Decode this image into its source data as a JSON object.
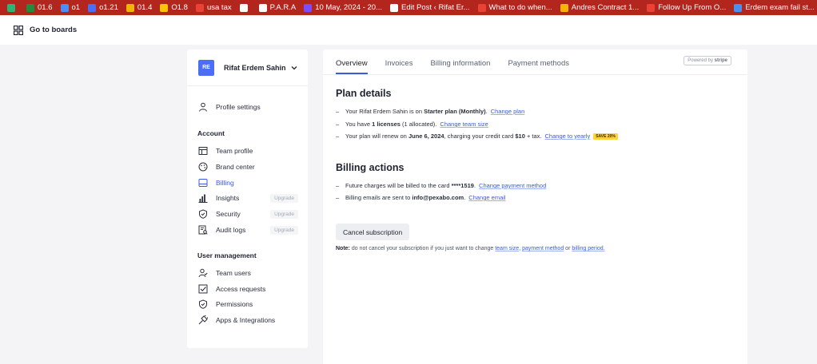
{
  "bookmarks": [
    {
      "label": "",
      "icon": "chat-icon",
      "color": "#2bb673"
    },
    {
      "label": "01.6",
      "icon": "plus-icon",
      "color": "#1e8e3e"
    },
    {
      "label": "o1",
      "icon": "shield-icon",
      "color": "#4c8df6"
    },
    {
      "label": "o1.21",
      "icon": "infinity-icon",
      "color": "#4c6ef5"
    },
    {
      "label": "01.4",
      "icon": "drive-icon",
      "color": "#f4b400"
    },
    {
      "label": "O1.8",
      "icon": "m-icon",
      "color": "#f9c400"
    },
    {
      "label": "usa tax",
      "icon": "gmail-icon",
      "color": "#ea4335"
    },
    {
      "label": "",
      "icon": "wordpress-icon",
      "color": "#ffffff"
    },
    {
      "label": "P.A.R.A",
      "icon": "folder-icon",
      "color": "#ffffff"
    },
    {
      "label": "10 May, 2024 - 20...",
      "icon": "clock-icon",
      "color": "#7c4dff"
    },
    {
      "label": "Edit Post ‹ Rifat Er...",
      "icon": "wordpress-icon",
      "color": "#ffffff"
    },
    {
      "label": "What to do when...",
      "icon": "gmail-icon",
      "color": "#ea4335"
    },
    {
      "label": "Andres Contract 1...",
      "icon": "drive-icon",
      "color": "#f4b400"
    },
    {
      "label": "Follow Up From O...",
      "icon": "gmail-icon",
      "color": "#ea4335"
    },
    {
      "label": "Erdem exam fail st...",
      "icon": "shield-icon",
      "color": "#4c8df6"
    },
    {
      "label": "",
      "icon": "calendar-icon",
      "color": "#4c8df6"
    },
    {
      "label": "",
      "icon": "app-icon",
      "color": "#ff6d00"
    }
  ],
  "topbar": {
    "go_to_boards": "Go to boards"
  },
  "workspace": {
    "initials": "RE",
    "name": "Rifat Erdem Sahin"
  },
  "sidebar": {
    "profile_settings": "Profile settings",
    "account_title": "Account",
    "account_items": [
      {
        "label": "Team profile",
        "icon": "team-profile-icon",
        "badge": ""
      },
      {
        "label": "Brand center",
        "icon": "palette-icon",
        "badge": ""
      },
      {
        "label": "Billing",
        "icon": "billing-icon",
        "badge": ""
      },
      {
        "label": "Insights",
        "icon": "insights-icon",
        "badge": "Upgrade"
      },
      {
        "label": "Security",
        "icon": "security-icon",
        "badge": "Upgrade"
      },
      {
        "label": "Audit logs",
        "icon": "audit-logs-icon",
        "badge": "Upgrade"
      }
    ],
    "user_mgmt_title": "User management",
    "user_items": [
      {
        "label": "Team users",
        "icon": "team-users-icon"
      },
      {
        "label": "Access requests",
        "icon": "access-requests-icon"
      },
      {
        "label": "Permissions",
        "icon": "permissions-icon"
      },
      {
        "label": "Apps & Integrations",
        "icon": "plug-icon"
      }
    ]
  },
  "tabs": [
    "Overview",
    "Invoices",
    "Billing information",
    "Payment methods"
  ],
  "stripe": {
    "powered": "Powered by",
    "brand": "stripe"
  },
  "plan": {
    "title": "Plan details",
    "l1_pre": "Your Rifat Erdem Sahin is on ",
    "l1_bold": "Starter plan (Monthly)",
    "l1_post": ".",
    "l1_link": "Change plan",
    "l2_pre": "You have ",
    "l2_bold": "1 licenses",
    "l2_post": " (1 allocated).",
    "l2_link": "Change team size",
    "l3_pre": "Your plan will renew on ",
    "l3_bold1": "June 6, 2024",
    "l3_mid": ", charging your credit card ",
    "l3_bold2": "$10",
    "l3_post": " + tax.",
    "l3_link": "Change to yearly",
    "save_badge": "SAVE 20%"
  },
  "billing": {
    "title": "Billing actions",
    "l1_pre": "Future charges will be billed to the card ",
    "l1_bold": "****1519",
    "l1_post": ".",
    "l1_link": "Change payment method",
    "l2_pre": "Billing emails are sent to ",
    "l2_bold": "info@pexabo.com",
    "l2_post": ".",
    "l2_link": "Change email",
    "cancel_button": "Cancel subscription",
    "note_bold": "Note:",
    "note_text": " do not cancel your subscription if you just want to change ",
    "note_link1": "team size",
    "note_sep1": ", ",
    "note_link2": "payment method",
    "note_sep2": " or ",
    "note_link3": "billing period."
  }
}
